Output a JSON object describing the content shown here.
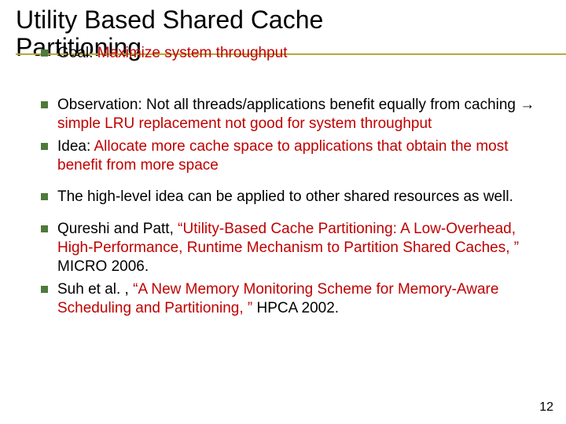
{
  "title_line1": "Utility Based Shared Cache",
  "title_line2": "Partitioning",
  "bullets": {
    "b0": {
      "pre": "Goal: ",
      "hi": "Maximize system throughput",
      "post": ""
    },
    "b1": {
      "pre": "Observation: Not all threads/applications benefit equally from caching → ",
      "hi": "simple LRU replacement not good for system throughput",
      "post": ""
    },
    "b2": {
      "pre": "Idea: ",
      "hi": "Allocate more cache space to applications that obtain the most benefit from more space",
      "post": ""
    },
    "b3": {
      "pre": "The high-level idea can be applied to other shared resources as well.",
      "hi": "",
      "post": ""
    },
    "b4": {
      "pre": "Qureshi and Patt, ",
      "hi": "“Utility-Based Cache Partitioning: A Low-Overhead, High-Performance, Runtime Mechanism to Partition Shared Caches, ”",
      "post": " MICRO 2006."
    },
    "b5": {
      "pre": "Suh et al. , ",
      "hi": "“A New Memory Monitoring Scheme for Memory-Aware Scheduling and Partitioning, ”",
      "post": " HPCA 2002."
    }
  },
  "pagenum": "12"
}
